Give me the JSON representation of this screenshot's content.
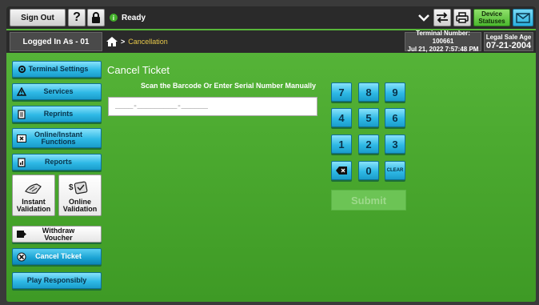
{
  "header": {
    "sign_out_label": "Sign Out",
    "help_label": "?",
    "status_text": "Ready",
    "device_statuses_label": "Device Statuses",
    "icons": [
      "lock-icon",
      "info-icon",
      "chevron-down-icon",
      "transfer-icon",
      "printer-icon",
      "mail-icon"
    ]
  },
  "subheader": {
    "logged_in": "Logged In As - 01",
    "breadcrumb": "Cancellation",
    "terminal_line1": "Terminal Number: 100661",
    "terminal_line2": "Jul 21, 2022 7:57:48 PM",
    "legal_label": "Legal Sale Age",
    "legal_date": "07-21-2004"
  },
  "sidebar": {
    "items": [
      {
        "label": "Terminal Settings",
        "icon": "gear-icon"
      },
      {
        "label": "Services",
        "icon": "warning-icon"
      },
      {
        "label": "Reprints",
        "icon": "document-icon"
      },
      {
        "label": "Online/Instant Functions",
        "icon": "ticket-x-icon"
      },
      {
        "label": "Reports",
        "icon": "report-icon"
      },
      {
        "label": "Withdraw Voucher",
        "icon": "voucher-icon"
      },
      {
        "label": "Cancel Ticket",
        "icon": "cancel-ticket-icon"
      },
      {
        "label": "Play Responsibly",
        "icon": ""
      }
    ],
    "instant_validation": "Instant Validation",
    "online_validation": "Online Validation"
  },
  "main": {
    "title": "Cancel Ticket",
    "instruction": "Scan the Barcode Or Enter Serial Number Manually",
    "serial_placeholder": "____-_________-______",
    "keys": [
      "7",
      "8",
      "9",
      "4",
      "5",
      "6",
      "1",
      "2",
      "3",
      "0"
    ],
    "clear_label": "CLEAR",
    "submit_label": "Submit"
  },
  "colors": {
    "background_green": "#4caa30",
    "button_blue": "#2fb9e6",
    "bar_dark": "#2a2a2a",
    "breadcrumb_gold": "#e7c84a"
  }
}
